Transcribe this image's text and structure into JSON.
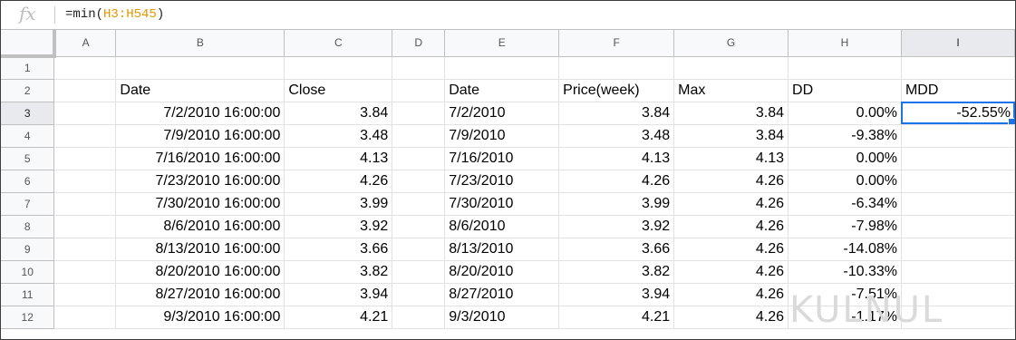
{
  "formula_bar": {
    "fx_icon": "fx",
    "formula_prefix": "=min(",
    "formula_ref": "H3:H545",
    "formula_suffix": ")"
  },
  "columns": [
    "A",
    "B",
    "C",
    "D",
    "E",
    "F",
    "G",
    "H",
    "I"
  ],
  "selected_column": "I",
  "selected_row": 3,
  "rows": [
    {
      "num": "1",
      "cells": [
        "",
        "",
        "",
        "",
        "",
        "",
        "",
        "",
        ""
      ]
    },
    {
      "num": "2",
      "cells": [
        "",
        "Date",
        "Close",
        "",
        "Date",
        "Price(week)",
        "Max",
        "DD",
        "MDD"
      ]
    },
    {
      "num": "3",
      "cells": [
        "",
        "7/2/2010 16:00:00",
        "3.84",
        "",
        "7/2/2010",
        "3.84",
        "3.84",
        "0.00%",
        "-52.55%"
      ]
    },
    {
      "num": "4",
      "cells": [
        "",
        "7/9/2010 16:00:00",
        "3.48",
        "",
        "7/9/2010",
        "3.48",
        "3.84",
        "-9.38%",
        ""
      ]
    },
    {
      "num": "5",
      "cells": [
        "",
        "7/16/2010 16:00:00",
        "4.13",
        "",
        "7/16/2010",
        "4.13",
        "4.13",
        "0.00%",
        ""
      ]
    },
    {
      "num": "6",
      "cells": [
        "",
        "7/23/2010 16:00:00",
        "4.26",
        "",
        "7/23/2010",
        "4.26",
        "4.26",
        "0.00%",
        ""
      ]
    },
    {
      "num": "7",
      "cells": [
        "",
        "7/30/2010 16:00:00",
        "3.99",
        "",
        "7/30/2010",
        "3.99",
        "4.26",
        "-6.34%",
        ""
      ]
    },
    {
      "num": "8",
      "cells": [
        "",
        "8/6/2010 16:00:00",
        "3.92",
        "",
        "8/6/2010",
        "3.92",
        "4.26",
        "-7.98%",
        ""
      ]
    },
    {
      "num": "9",
      "cells": [
        "",
        "8/13/2010 16:00:00",
        "3.66",
        "",
        "8/13/2010",
        "3.66",
        "4.26",
        "-14.08%",
        ""
      ]
    },
    {
      "num": "10",
      "cells": [
        "",
        "8/20/2010 16:00:00",
        "3.82",
        "",
        "8/20/2010",
        "3.82",
        "4.26",
        "-10.33%",
        ""
      ]
    },
    {
      "num": "11",
      "cells": [
        "",
        "8/27/2010 16:00:00",
        "3.94",
        "",
        "8/27/2010",
        "3.94",
        "4.26",
        "-7.51%",
        ""
      ]
    },
    {
      "num": "12",
      "cells": [
        "",
        "9/3/2010 16:00:00",
        "4.21",
        "",
        "9/3/2010",
        "4.21",
        "4.26",
        "-1.17%",
        ""
      ]
    }
  ],
  "watermark": "KULNUL"
}
